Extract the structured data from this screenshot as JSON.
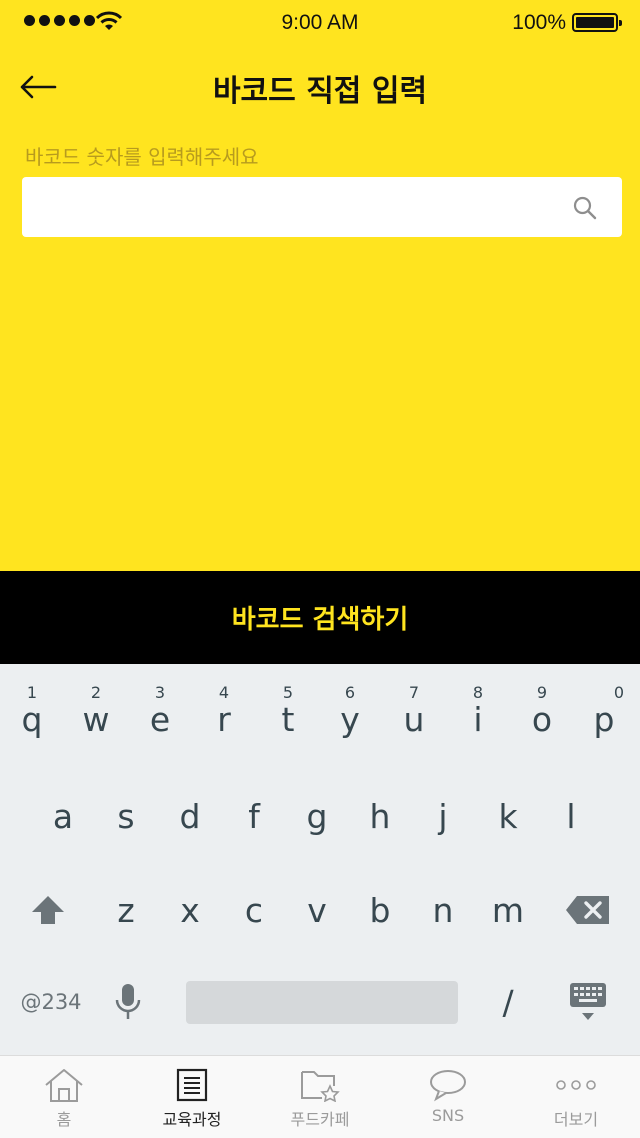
{
  "status_bar": {
    "time": "9:00 AM",
    "battery_percent": "100%"
  },
  "header": {
    "title": "바코드 직접 입력"
  },
  "search": {
    "hint": "바코드 숫자를 입력해주세요",
    "value": ""
  },
  "submit": {
    "label": "바코드 검색하기"
  },
  "keyboard": {
    "row1": [
      {
        "key": "q",
        "hint": "1"
      },
      {
        "key": "w",
        "hint": "2"
      },
      {
        "key": "e",
        "hint": "3"
      },
      {
        "key": "r",
        "hint": "4"
      },
      {
        "key": "t",
        "hint": "5"
      },
      {
        "key": "y",
        "hint": "6"
      },
      {
        "key": "u",
        "hint": "7"
      },
      {
        "key": "i",
        "hint": "8"
      },
      {
        "key": "o",
        "hint": "9"
      },
      {
        "key": "p",
        "hint": "0"
      }
    ],
    "row2": [
      "a",
      "s",
      "d",
      "f",
      "g",
      "h",
      "j",
      "k",
      "l"
    ],
    "row3": [
      "z",
      "x",
      "c",
      "v",
      "b",
      "n",
      "m"
    ],
    "symbols_label": "@234",
    "slash": "/",
    "icons": {
      "shift": "shift-arrow-icon",
      "backspace": "backspace-icon",
      "mic": "microphone-icon",
      "keyboard": "keyboard-hide-icon"
    }
  },
  "tabbar": {
    "items": [
      {
        "label": "홈",
        "icon": "home-icon",
        "active": false
      },
      {
        "label": "교육과정",
        "icon": "document-list-icon",
        "active": true
      },
      {
        "label": "푸드카페",
        "icon": "folder-star-icon",
        "active": false
      },
      {
        "label": "SNS",
        "icon": "chat-bubble-icon",
        "active": false
      },
      {
        "label": "더보기",
        "icon": "more-dots-icon",
        "active": false
      }
    ]
  },
  "colors": {
    "brand_yellow": "#ffe41f",
    "button_black": "#000000",
    "hint_text": "#b79b1e",
    "keyboard_bg": "#eceff1"
  }
}
